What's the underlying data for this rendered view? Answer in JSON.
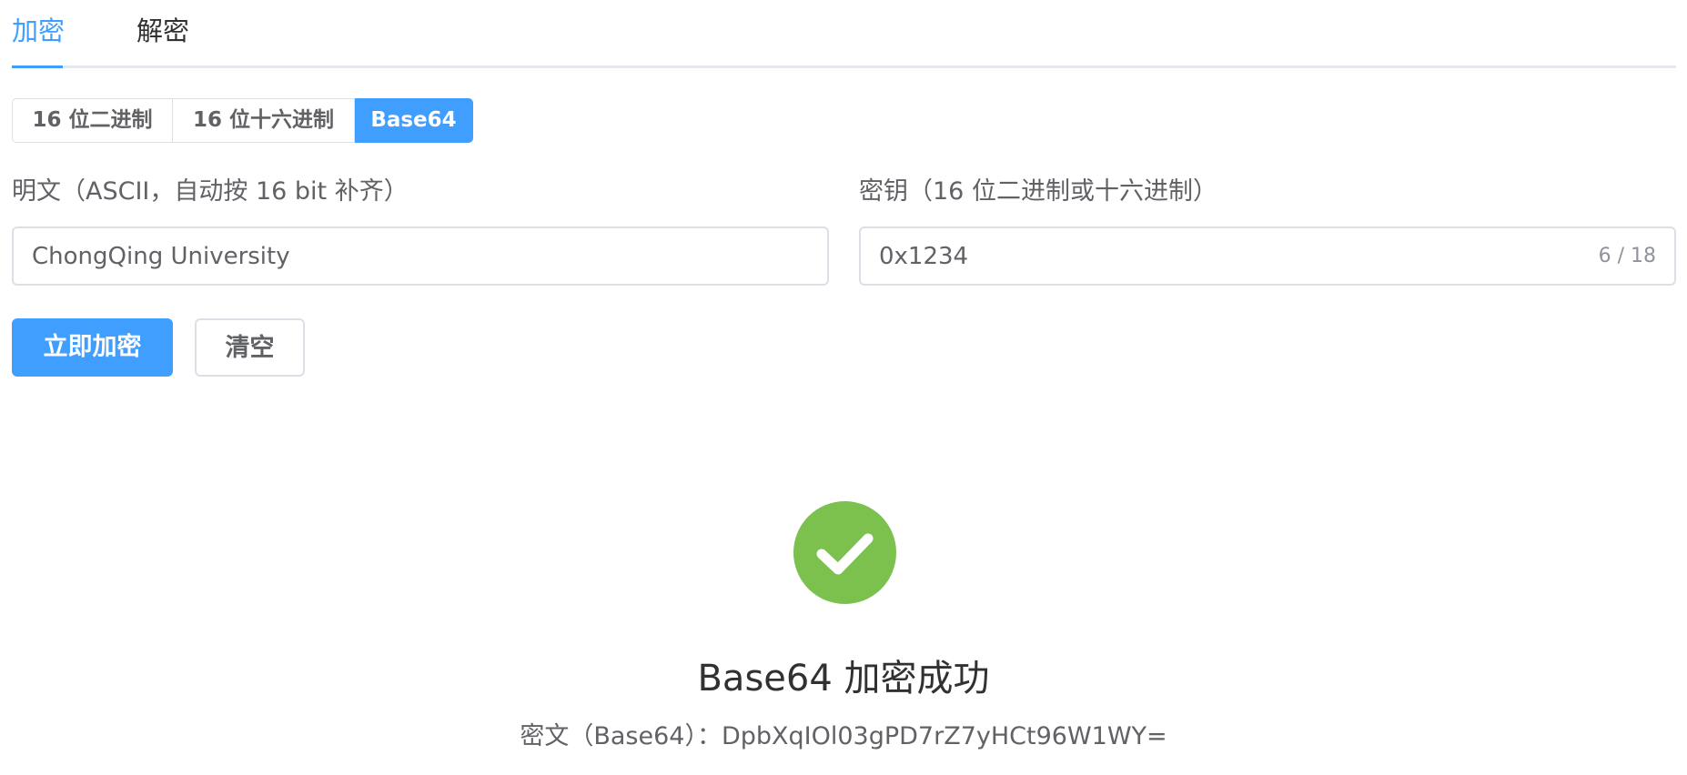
{
  "tabs": {
    "encrypt": "加密",
    "decrypt": "解密",
    "active": "encrypt"
  },
  "formats": {
    "options": [
      "16 位二进制",
      "16 位十六进制",
      "Base64"
    ],
    "selected": "Base64"
  },
  "plaintext": {
    "label": "明文（ASCII，自动按 16 bit 补齐）",
    "value": "ChongQing University"
  },
  "key": {
    "label": "密钥（16 位二进制或十六进制）",
    "value": "0x1234",
    "counter": "6 / 18"
  },
  "actions": {
    "encrypt_label": "立即加密",
    "clear_label": "清空"
  },
  "result": {
    "icon": "check-circle-icon",
    "title": "Base64 加密成功",
    "subtitle": "密文（Base64）：DpbXqIOl03gPD7rZ7yHCt96W1WY="
  },
  "colors": {
    "accent": "#409eff",
    "success": "#7cc04e",
    "border": "#dcdfe6"
  }
}
